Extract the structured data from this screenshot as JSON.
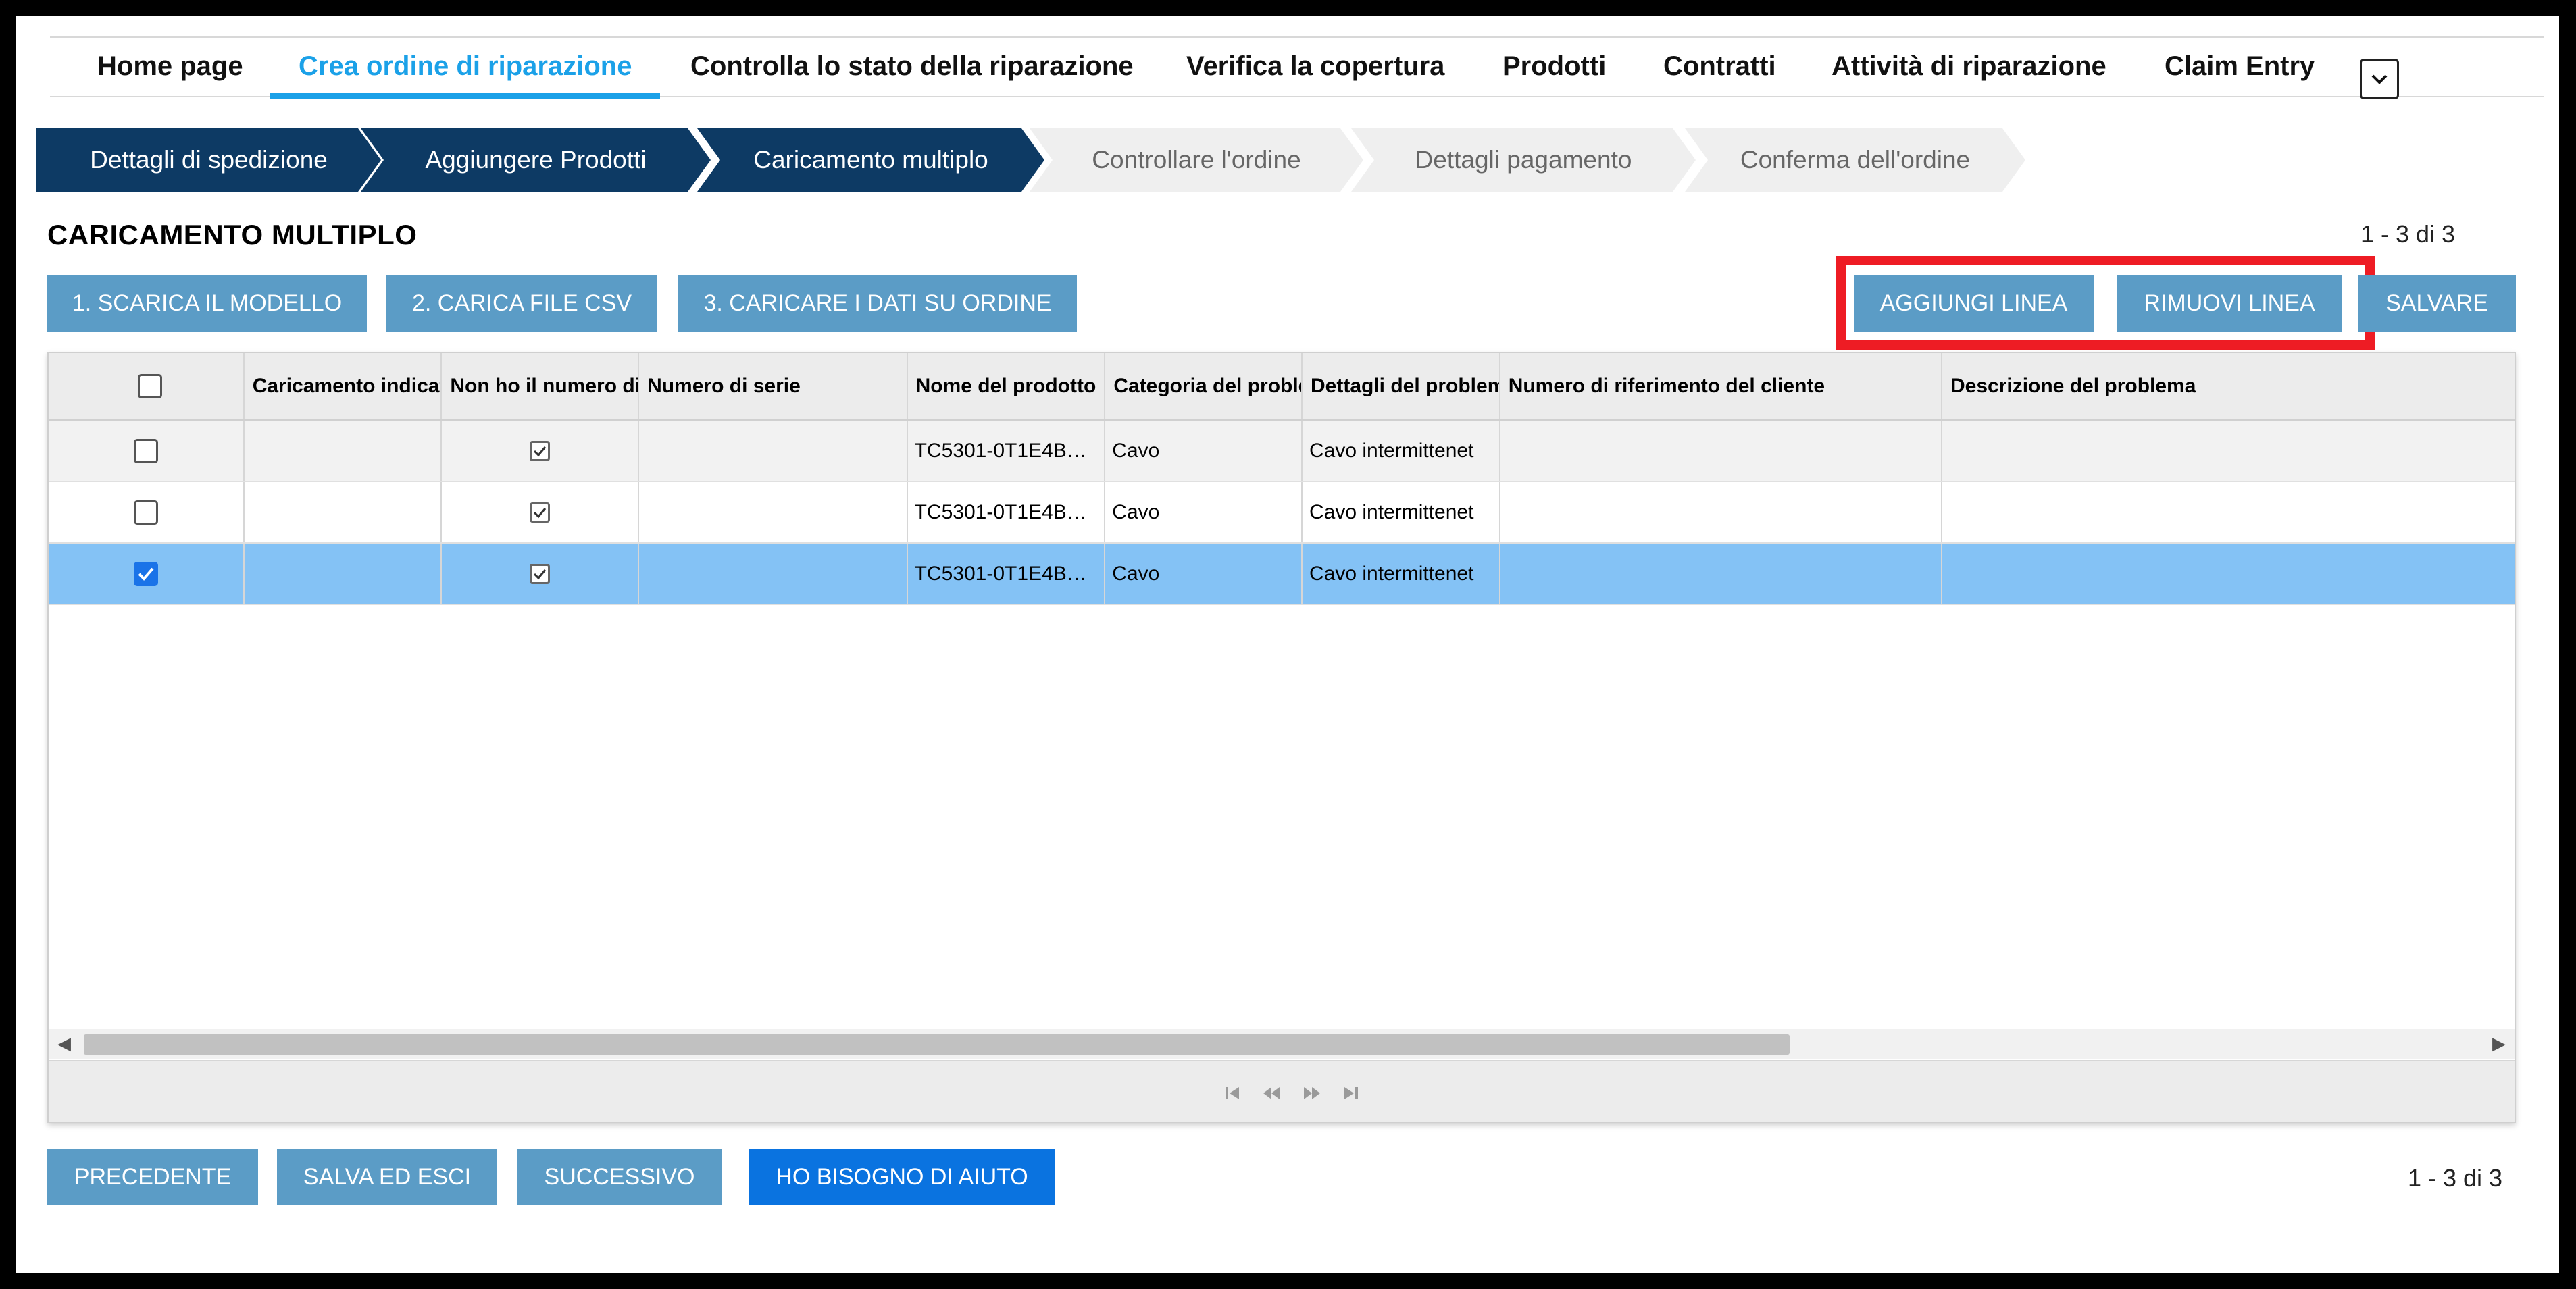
{
  "nav": {
    "items": [
      {
        "label": "Home page"
      },
      {
        "label": "Crea ordine di riparazione"
      },
      {
        "label": "Controlla lo stato della riparazione"
      },
      {
        "label": "Verifica la copertura"
      },
      {
        "label": "Prodotti"
      },
      {
        "label": "Contratti"
      },
      {
        "label": "Attività di riparazione"
      },
      {
        "label": "Claim Entry"
      }
    ],
    "active_index": 1,
    "more_icon": "chevron-down-icon"
  },
  "steps": [
    {
      "label": "Dettagli di spedizione",
      "state": "done"
    },
    {
      "label": "Aggiungere Prodotti",
      "state": "done"
    },
    {
      "label": "Caricamento multiplo",
      "state": "current"
    },
    {
      "label": "Controllare l'ordine",
      "state": "todo"
    },
    {
      "label": "Dettagli pagamento",
      "state": "todo"
    },
    {
      "label": "Conferma dell'ordine",
      "state": "todo"
    }
  ],
  "page": {
    "title": "CARICAMENTO MULTIPLO",
    "pager_top": "1 - 3 di 3",
    "pager_bottom": "1 - 3 di 3"
  },
  "toolbar": {
    "download_template": "1. SCARICA IL MODELLO",
    "upload_csv": "2. CARICA FILE CSV",
    "load_to_order": "3. CARICARE I DATI SU ORDINE",
    "add_line": "AGGIUNGI LINEA",
    "remove_line": "RIMUOVI LINEA",
    "save": "SALVARE"
  },
  "grid": {
    "columns": [
      "Caricamento indicato",
      "Non ho il numero di serie",
      "Numero di serie",
      "Nome del prodotto",
      "Categoria del problema",
      "Dettagli del problema",
      "Numero di riferimento del cliente",
      "Descrizione del problema"
    ],
    "rows": [
      {
        "selected": false,
        "no_serial": true,
        "serial": "",
        "product": "TC5301-0T1E4B…",
        "category": "Cavo",
        "details": "Cavo intermittenet",
        "customer_ref": "",
        "description": ""
      },
      {
        "selected": false,
        "no_serial": true,
        "serial": "",
        "product": "TC5301-0T1E4B…",
        "category": "Cavo",
        "details": "Cavo intermittenet",
        "customer_ref": "",
        "description": ""
      },
      {
        "selected": true,
        "no_serial": true,
        "serial": "",
        "product": "TC5301-0T1E4B…",
        "category": "Cavo",
        "details": "Cavo intermittenet",
        "customer_ref": "",
        "description": ""
      }
    ]
  },
  "footer": {
    "previous": "PRECEDENTE",
    "save_exit": "SALVA ED ESCI",
    "next": "SUCCESSIVO",
    "help": "HO BISOGNO DI AIUTO"
  },
  "colors": {
    "accent": "#1ba1e8",
    "step_done": "#0d3a64",
    "button": "#5b9cc6",
    "button_primary": "#0a73e0",
    "selected_row": "#84c2f5",
    "highlight": "#ee1c24"
  }
}
